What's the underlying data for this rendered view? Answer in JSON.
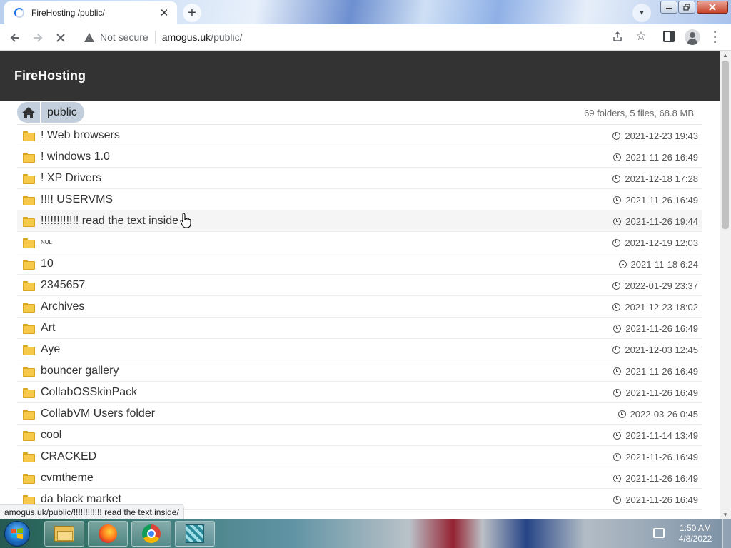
{
  "browser": {
    "tab_title": "FireHosting /public/",
    "tab_close_glyph": "✕",
    "new_tab_glyph": "+",
    "tab_search_glyph": "▾",
    "omnibox": {
      "security_label": "Not secure",
      "url_host": "amogus.uk",
      "url_path": "/public/"
    },
    "status_text": "amogus.uk/public/!!!!!!!!!!!! read the text inside/"
  },
  "page": {
    "site_title": "FireHosting",
    "breadcrumb": {
      "current": "public"
    },
    "summary": "69 folders, 5 files, 68.8 MB",
    "entries": [
      {
        "name": "! Web browsers",
        "date": "2021-12-23 19:43"
      },
      {
        "name": "! windows 1.0",
        "date": "2021-11-26 16:49"
      },
      {
        "name": "! XP Drivers",
        "date": "2021-12-18 17:28"
      },
      {
        "name": "!!!! USERVMS",
        "date": "2021-11-26 16:49"
      },
      {
        "name": "!!!!!!!!!!!! read the text inside",
        "date": "2021-11-26 19:44"
      },
      {
        "name": "NUL",
        "date": "2021-12-19 12:03"
      },
      {
        "name": "10",
        "date": "2021-11-18 6:24"
      },
      {
        "name": "2345657",
        "date": "2022-01-29 23:37"
      },
      {
        "name": "Archives",
        "date": "2021-12-23 18:02"
      },
      {
        "name": "Art",
        "date": "2021-11-26 16:49"
      },
      {
        "name": "Aye",
        "date": "2021-12-03 12:45"
      },
      {
        "name": "bouncer gallery",
        "date": "2021-11-26 16:49"
      },
      {
        "name": "CollabOSSkinPack",
        "date": "2021-11-26 16:49"
      },
      {
        "name": "CollabVM Users folder",
        "date": "2022-03-26 0:45"
      },
      {
        "name": "cool",
        "date": "2021-11-14 13:49"
      },
      {
        "name": "CRACKED",
        "date": "2021-11-26 16:49"
      },
      {
        "name": "cvmtheme",
        "date": "2021-11-26 16:49"
      },
      {
        "name": "da black market",
        "date": "2021-11-26 16:49"
      }
    ]
  },
  "taskbar": {
    "apps": [
      "explorer",
      "firefox",
      "chrome",
      "vmware"
    ],
    "clock_time": "1:50 AM",
    "clock_date": "4/8/2022"
  },
  "colors": {
    "header_bg": "#333333",
    "breadcrumb_bg": "#c3cfdc",
    "folder_yellow": "#f6c94a"
  }
}
